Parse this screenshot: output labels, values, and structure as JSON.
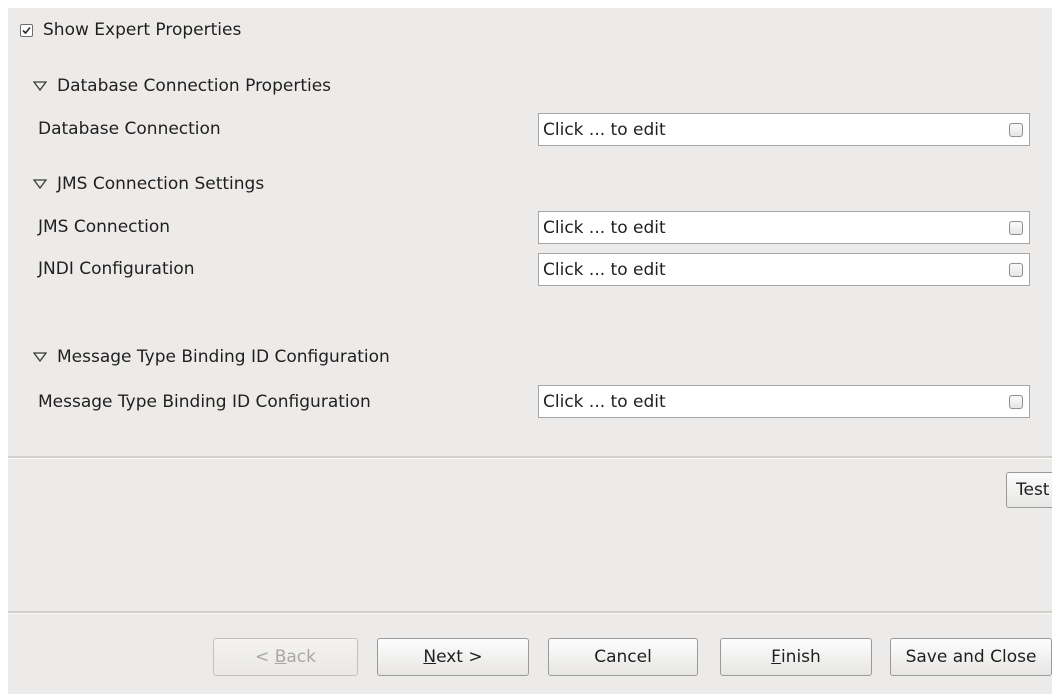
{
  "expert": {
    "checked": true,
    "label": "Show Expert Properties"
  },
  "sections": [
    {
      "title": "Database Connection Properties",
      "properties": [
        {
          "label": "Database Connection",
          "value": "Click ... to edit"
        }
      ]
    },
    {
      "title": "JMS Connection Settings",
      "properties": [
        {
          "label": "JMS Connection",
          "value": "Click ... to edit"
        },
        {
          "label": "JNDI Configuration",
          "value": "Click ... to edit"
        }
      ]
    },
    {
      "title": "Message Type Binding ID Configuration",
      "properties": [
        {
          "label": "Message Type Binding ID Configuration",
          "value": "Click ... to edit"
        }
      ]
    }
  ],
  "test_button": "Test",
  "wizard": {
    "back": {
      "prefix": "< ",
      "mnemonic": "B",
      "rest": "ack",
      "enabled": false
    },
    "next": {
      "prefix": "",
      "mnemonic": "N",
      "rest": "ext >",
      "enabled": true
    },
    "cancel": {
      "label": "Cancel",
      "enabled": true
    },
    "finish": {
      "prefix": "",
      "mnemonic": "F",
      "rest": "inish",
      "enabled": true
    },
    "save_close": {
      "label": "Save and Close",
      "enabled": true
    }
  }
}
